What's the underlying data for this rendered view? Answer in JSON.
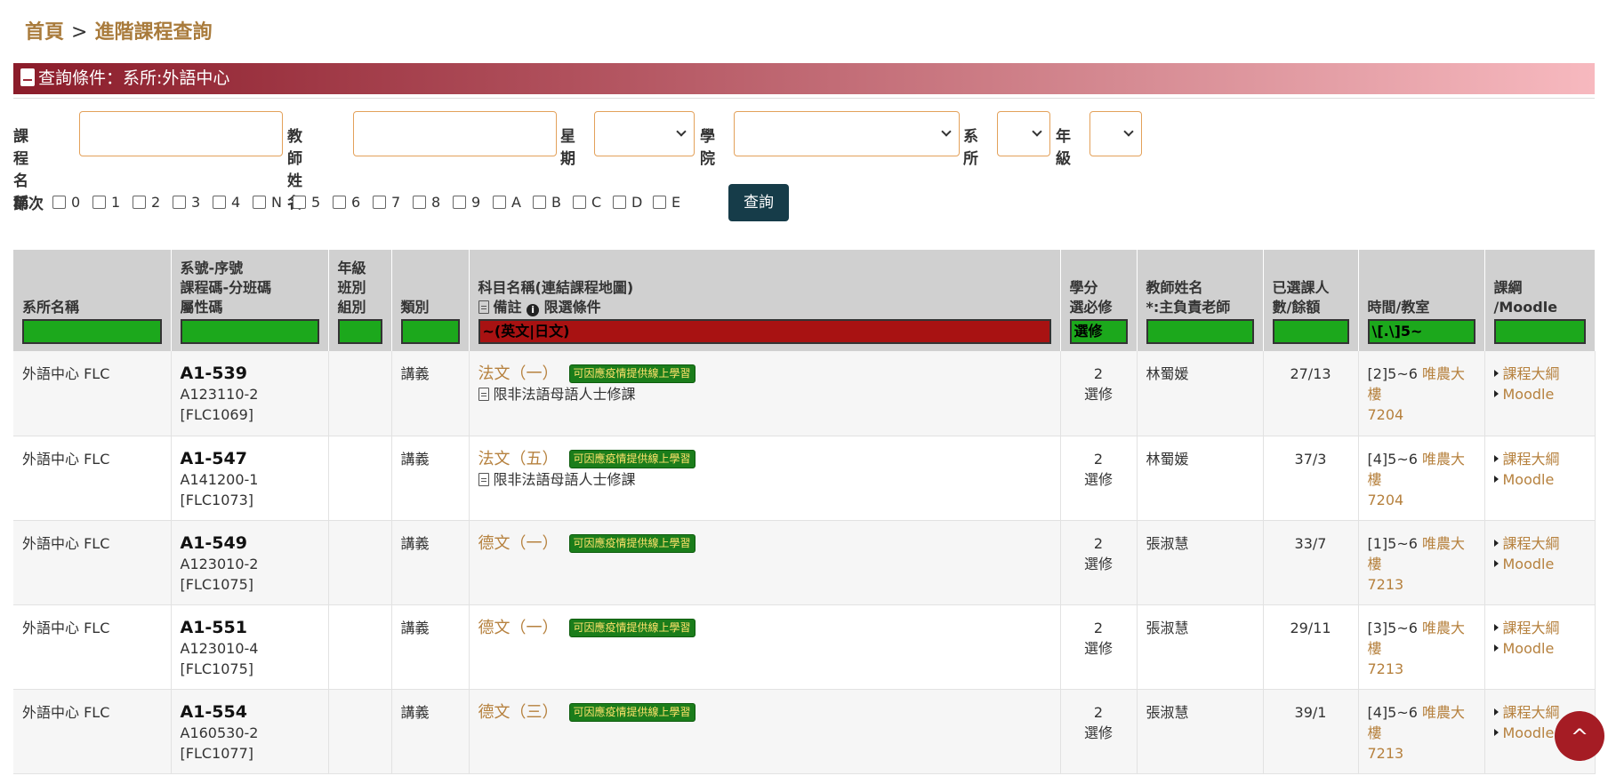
{
  "breadcrumb": {
    "home": "首頁",
    "sep": ">",
    "current": "進階課程查詢"
  },
  "condition_bar": {
    "text": "查詢條件：系所:外語中心"
  },
  "filters": {
    "course_name_label": "課程名稱",
    "teacher_label": "教師姓名",
    "weekday_label": "星期",
    "college_label": "學院",
    "dept_label": "系所",
    "grade_label": "年級",
    "period_label": "節次",
    "periods": [
      "0",
      "1",
      "2",
      "3",
      "4",
      "N",
      "5",
      "6",
      "7",
      "8",
      "9",
      "A",
      "B",
      "C",
      "D",
      "E"
    ],
    "query_button": "查詢"
  },
  "table": {
    "headers": {
      "dept": "系所名稱",
      "code_l1": "系號-序號",
      "code_l2": "課程碼-分班碼",
      "code_l3": "屬性碼",
      "grade_l1": "年級",
      "grade_l2": "班別",
      "grade_l3": "組別",
      "type": "類別",
      "subject_l1": "科目名稱(連結課程地圖)",
      "subject_l2a": "備註",
      "subject_l2b": "限選條件",
      "credit_l1": "學分",
      "credit_l2": "選必修",
      "teacher_l1": "教師姓名",
      "teacher_l2": "*:主負責老師",
      "enroll_l1": "已選課人",
      "enroll_l2": "數/餘額",
      "time": "時間/教室",
      "syllabus_l1": "課綱",
      "syllabus_l2": "/Moodle"
    },
    "header_filters": {
      "subject": "~(英文|日文)",
      "credit": "選修",
      "time": "\\[.\\]5~"
    },
    "rows": [
      {
        "dept": "外語中心 FLC",
        "code": "A1-539",
        "course_code": "A123110-2",
        "attr": "[FLC1069]",
        "type": "講義",
        "name": "法文（一）",
        "tag": "可因應疫情提供線上學習",
        "note": "限非法語母語人士修課",
        "credit": "2",
        "req": "選修",
        "teacher": "林蜀媛",
        "enroll": "27/13",
        "time": "[2]5~6",
        "room": "唯農大樓",
        "room_no": "7204",
        "syllabus": "課程大綱",
        "moodle": "Moodle"
      },
      {
        "dept": "外語中心 FLC",
        "code": "A1-547",
        "course_code": "A141200-1",
        "attr": "[FLC1073]",
        "type": "講義",
        "name": "法文（五）",
        "tag": "可因應疫情提供線上學習",
        "note": "限非法語母語人士修課",
        "credit": "2",
        "req": "選修",
        "teacher": "林蜀媛",
        "enroll": "37/3",
        "time": "[4]5~6",
        "room": "唯農大樓",
        "room_no": "7204",
        "syllabus": "課程大綱",
        "moodle": "Moodle"
      },
      {
        "dept": "外語中心 FLC",
        "code": "A1-549",
        "course_code": "A123010-2",
        "attr": "[FLC1075]",
        "type": "講義",
        "name": "德文（一）",
        "tag": "可因應疫情提供線上學習",
        "note": "",
        "credit": "2",
        "req": "選修",
        "teacher": "張淑慧",
        "enroll": "33/7",
        "time": "[1]5~6",
        "room": "唯農大樓",
        "room_no": "7213",
        "syllabus": "課程大綱",
        "moodle": "Moodle"
      },
      {
        "dept": "外語中心 FLC",
        "code": "A1-551",
        "course_code": "A123010-4",
        "attr": "[FLC1075]",
        "type": "講義",
        "name": "德文（一）",
        "tag": "可因應疫情提供線上學習",
        "note": "",
        "credit": "2",
        "req": "選修",
        "teacher": "張淑慧",
        "enroll": "29/11",
        "time": "[3]5~6",
        "room": "唯農大樓",
        "room_no": "7213",
        "syllabus": "課程大綱",
        "moodle": "Moodle"
      },
      {
        "dept": "外語中心 FLC",
        "code": "A1-554",
        "course_code": "A160530-2",
        "attr": "[FLC1077]",
        "type": "講義",
        "name": "德文（三）",
        "tag": "可因應疫情提供線上學習",
        "note": "",
        "credit": "2",
        "req": "選修",
        "teacher": "張淑慧",
        "enroll": "39/1",
        "time": "[4]5~6",
        "room": "唯農大樓",
        "room_no": "7213",
        "syllabus": "課程大綱",
        "moodle": "Moodle"
      }
    ]
  },
  "back_to_top": "^"
}
